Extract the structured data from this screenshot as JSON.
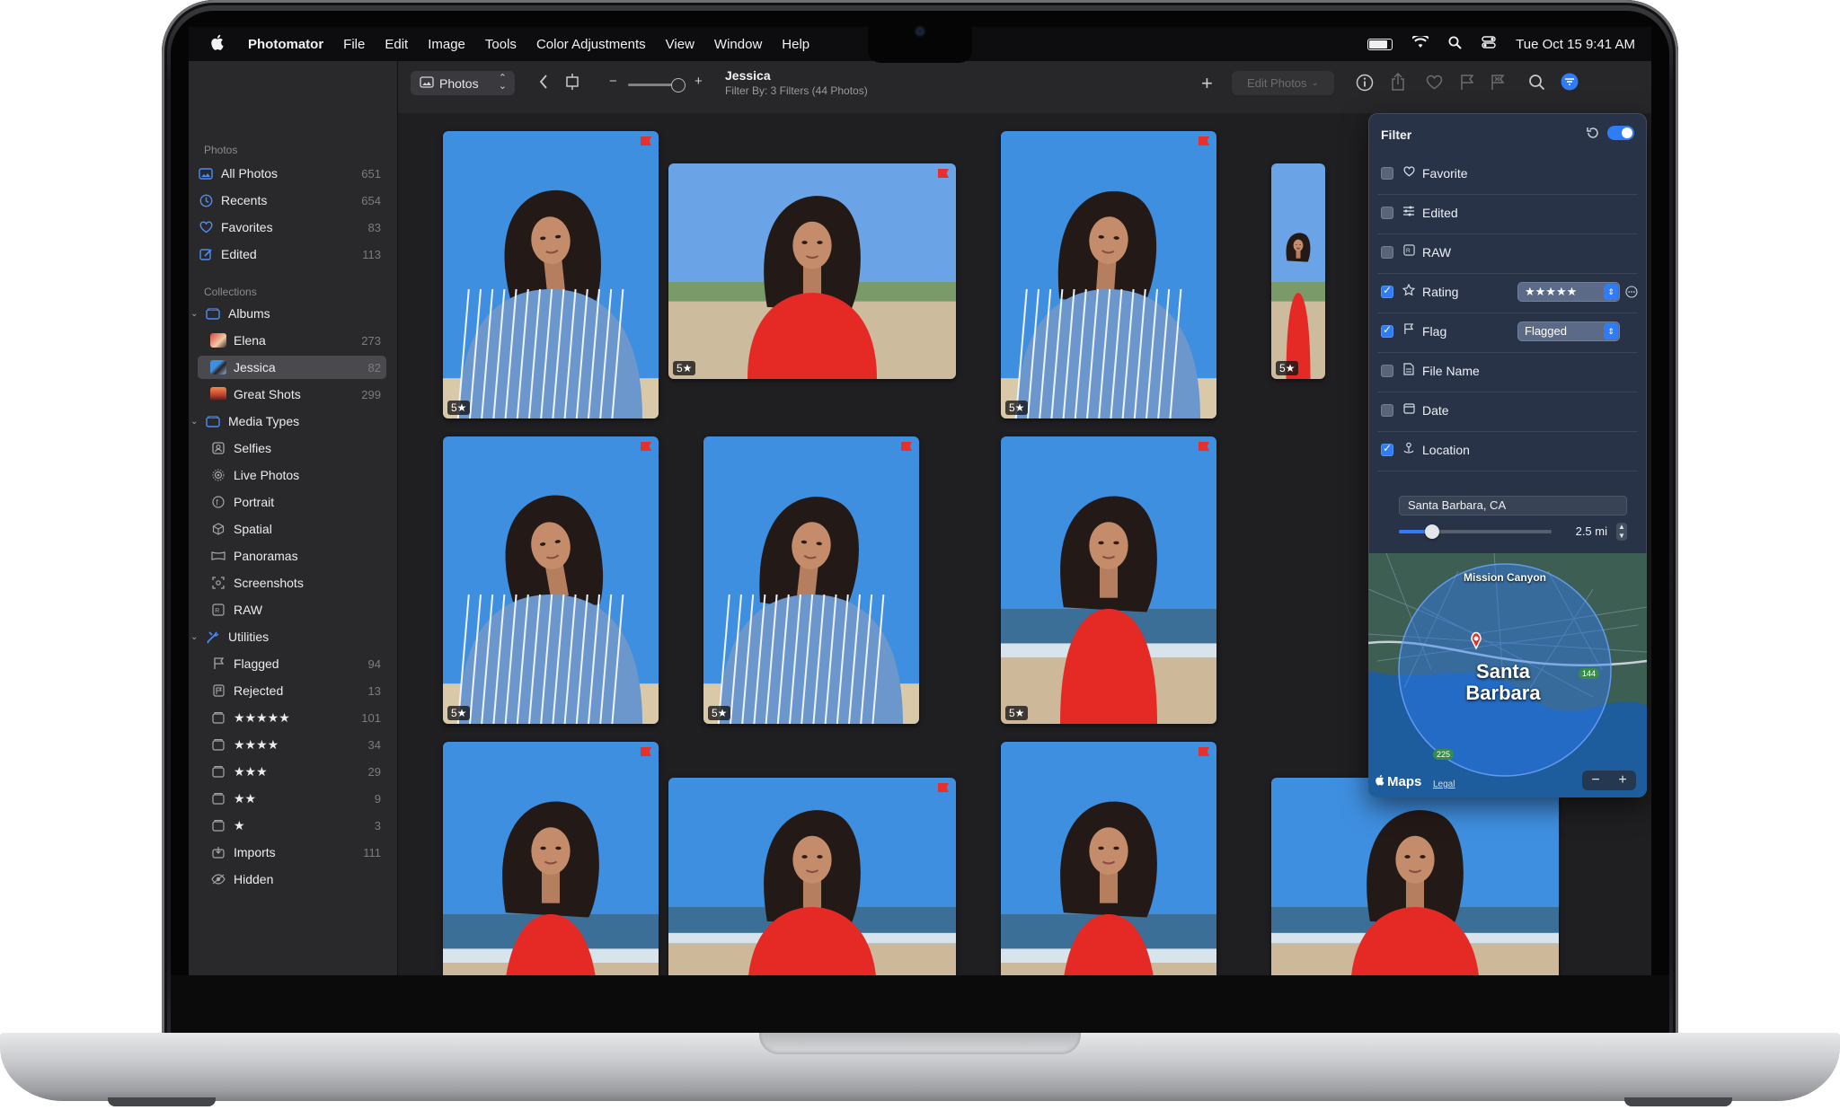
{
  "menubar": {
    "app_name": "Photomator",
    "items": [
      "File",
      "Edit",
      "Image",
      "Tools",
      "Color Adjustments",
      "View",
      "Window",
      "Help"
    ],
    "clock": "Tue Oct 15  9:41 AM"
  },
  "sidebar": {
    "photos_title": "Photos",
    "photos": [
      {
        "label": "All Photos",
        "count": "651",
        "icon": "photos-icon"
      },
      {
        "label": "Recents",
        "count": "654",
        "icon": "clock-icon"
      },
      {
        "label": "Favorites",
        "count": "83",
        "icon": "heart-icon"
      },
      {
        "label": "Edited",
        "count": "113",
        "icon": "edit-icon"
      }
    ],
    "collections_title": "Collections",
    "albums_label": "Albums",
    "albums": [
      {
        "label": "Elena",
        "count": "273"
      },
      {
        "label": "Jessica",
        "count": "82"
      },
      {
        "label": "Great Shots",
        "count": "299"
      }
    ],
    "media_types_label": "Media Types",
    "media_types": [
      {
        "label": "Selfies",
        "icon": "selfie-icon"
      },
      {
        "label": "Live Photos",
        "icon": "live-photo-icon"
      },
      {
        "label": "Portrait",
        "icon": "portrait-icon"
      },
      {
        "label": "Spatial",
        "icon": "spatial-icon"
      },
      {
        "label": "Panoramas",
        "icon": "panorama-icon"
      },
      {
        "label": "Screenshots",
        "icon": "screenshot-icon"
      },
      {
        "label": "RAW",
        "icon": "raw-icon"
      }
    ],
    "utilities_label": "Utilities",
    "utilities": [
      {
        "label": "Flagged",
        "count": "94",
        "icon": "flag-icon"
      },
      {
        "label": "Rejected",
        "count": "13",
        "icon": "rejected-flag-icon"
      },
      {
        "label": "★★★★★",
        "count": "101",
        "icon": "rating-icon"
      },
      {
        "label": "★★★★",
        "count": "34",
        "icon": "rating-icon"
      },
      {
        "label": "★★★",
        "count": "29",
        "icon": "rating-icon"
      },
      {
        "label": "★★",
        "count": "9",
        "icon": "rating-icon"
      },
      {
        "label": "★",
        "count": "3",
        "icon": "rating-icon"
      },
      {
        "label": "Imports",
        "count": "111",
        "icon": "import-icon"
      },
      {
        "label": "Hidden",
        "count": "",
        "icon": "eye-icon"
      }
    ]
  },
  "toolbar": {
    "view_popup": "Photos",
    "title": "Jessica",
    "subtitle": "Filter By: 3 Filters (44 Photos)",
    "edit_photos": "Edit Photos"
  },
  "photos": [
    {
      "badge": "5★",
      "flagged": true
    },
    {
      "badge": "5★",
      "flagged": true
    },
    {
      "badge": "5★",
      "flagged": true
    },
    {
      "badge": "5★",
      "flagged": false
    },
    {
      "badge": "5★",
      "flagged": true
    },
    {
      "badge": "5★",
      "flagged": true
    },
    {
      "badge": "5★",
      "flagged": true
    },
    {
      "badge": "",
      "flagged": true
    },
    {
      "badge": "",
      "flagged": true
    },
    {
      "badge": "",
      "flagged": true
    },
    {
      "badge": "",
      "flagged": false
    }
  ],
  "filter": {
    "title": "Filter",
    "rows": [
      {
        "label": "Favorite",
        "checked": false,
        "icon": "heart-icon"
      },
      {
        "label": "Edited",
        "checked": false,
        "icon": "sliders-icon"
      },
      {
        "label": "RAW",
        "checked": false,
        "icon": "raw-icon"
      },
      {
        "label": "Rating",
        "checked": true,
        "icon": "star-icon",
        "value": "★★★★★"
      },
      {
        "label": "Flag",
        "checked": true,
        "icon": "flag-icon",
        "value": "Flagged"
      },
      {
        "label": "File Name",
        "checked": false,
        "icon": "document-icon"
      },
      {
        "label": "Date",
        "checked": false,
        "icon": "calendar-icon"
      },
      {
        "label": "Location",
        "checked": true,
        "icon": "location-icon"
      }
    ],
    "location_value": "Santa Barbara, CA",
    "radius_label": "2.5 mi",
    "radius_fraction": 0.22,
    "map": {
      "place_top": "Mission Canyon",
      "city_line1": "Santa",
      "city_line2": "Barbara",
      "route_a": "225",
      "route_b": "144",
      "brand": "Maps",
      "legal": "Legal"
    }
  },
  "colors": {
    "accent": "#2f7cf6",
    "flag": "#e5302c",
    "sky": "#3f8fe0",
    "shirt_stripe": "#6b97cc",
    "tank_top": "#e52a26"
  }
}
